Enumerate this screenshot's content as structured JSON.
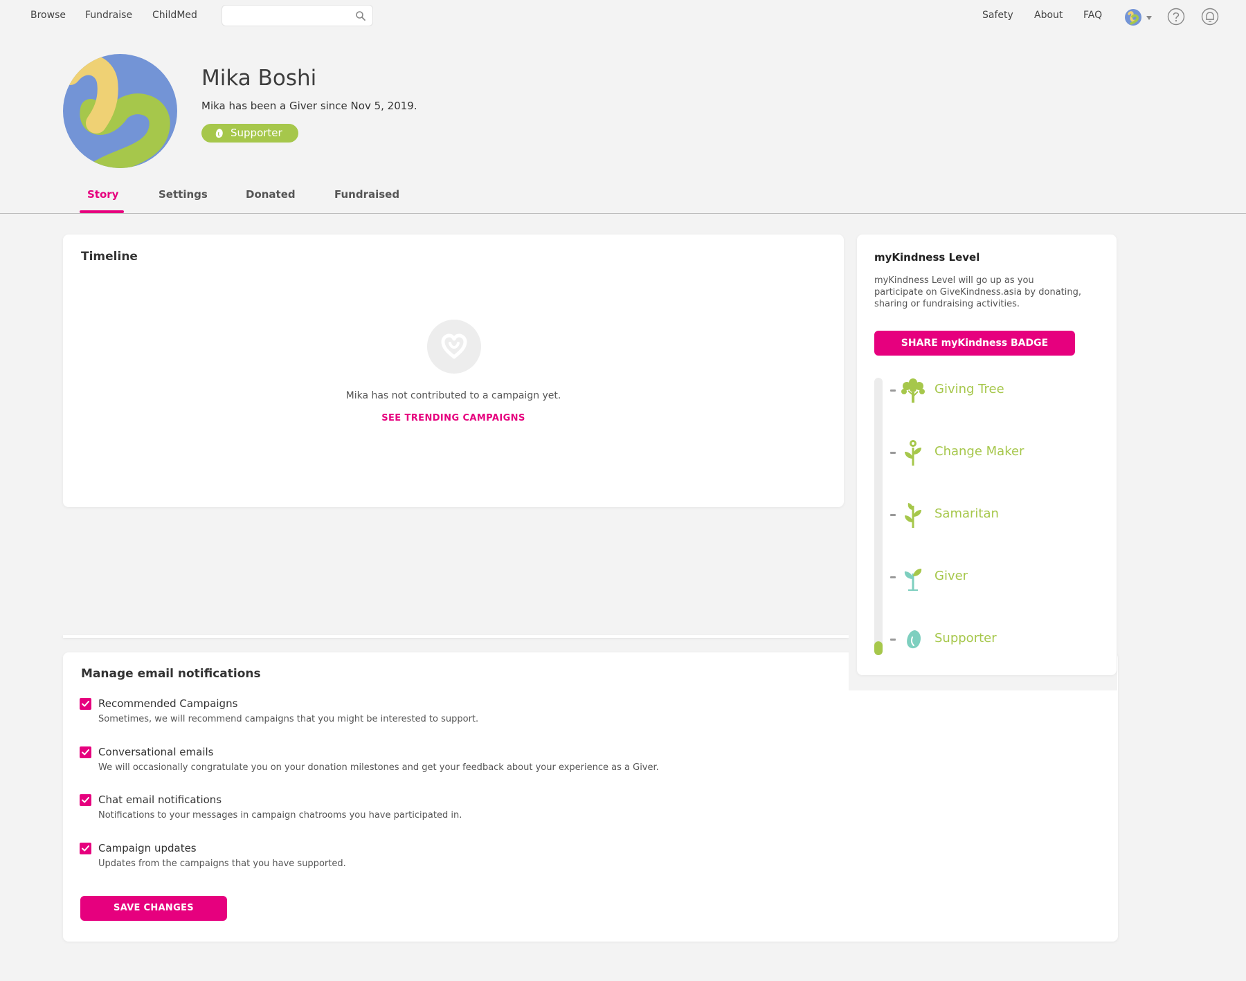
{
  "nav": {
    "left_links": [
      "Browse",
      "Fundraise",
      "ChildMed"
    ],
    "search_placeholder": "",
    "right_links": [
      "Safety",
      "About",
      "FAQ"
    ],
    "icons": [
      "search-icon",
      "avatar-icon",
      "chevron-down-icon",
      "help-icon",
      "bell-icon"
    ]
  },
  "profile": {
    "name": "Mika Boshi",
    "since": "Mika has been a Giver since Nov 5, 2019.",
    "level": "Supporter"
  },
  "tabs": [
    "Story",
    "Settings",
    "Donated",
    "Fundraised"
  ],
  "active_tab": "Story",
  "timeline": {
    "title": "Timeline",
    "empty_text": "Mika has not contributed to a campaign yet.",
    "cta": "SEE TRENDING CAMPAIGNS"
  },
  "kindness": {
    "title": "myKindness Level",
    "description": "myKindness Level will go up as you participate on GiveKindness.asia by donating, sharing or fundraising activities.",
    "share_button": "SHARE myKindness BADGE",
    "levels": [
      "Giving Tree",
      "Change Maker",
      "Samaritan",
      "Giver",
      "Supporter"
    ],
    "current_level_index": 4,
    "progress_fraction": 0.05
  },
  "email": {
    "title": "Manage email notifications",
    "prefs": [
      {
        "label": "Recommended Campaigns",
        "description": "Sometimes, we will recommend campaigns that you might be interested to support.",
        "checked": true
      },
      {
        "label": "Conversational emails",
        "description": "We will occasionally congratulate you on your donation milestones and get your feedback about your experience as a Giver.",
        "checked": true
      },
      {
        "label": "Chat email notifications",
        "description": "Notifications to your messages in campaign chatrooms you have participated in.",
        "checked": true
      },
      {
        "label": "Campaign updates",
        "description": "Updates from the campaigns that you have supported.",
        "checked": true
      }
    ],
    "save_button": "SAVE CHANGES"
  },
  "colors": {
    "accent": "#e6007e",
    "level_green": "#a6c74b",
    "avatar_blue": "#7394d6",
    "avatar_yellow": "#efd174"
  }
}
